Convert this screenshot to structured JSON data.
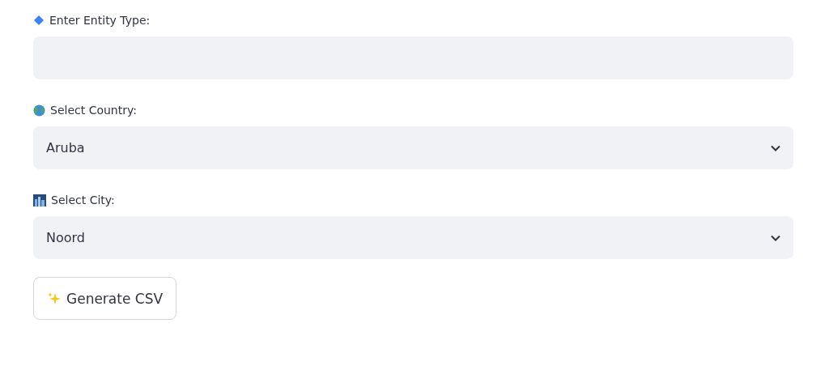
{
  "fields": [
    {
      "kind": "text",
      "label": "Enter Entity Type:"
    },
    {
      "kind": "select",
      "label": "Select Country:",
      "value": "Aruba"
    },
    {
      "kind": "select",
      "label": "Select City:",
      "value": "Noord"
    }
  ],
  "button": {
    "label": "Generate CSV"
  }
}
